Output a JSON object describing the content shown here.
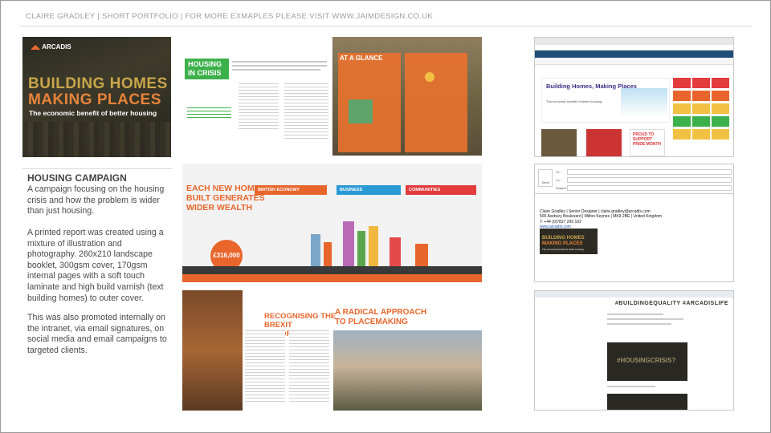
{
  "header": {
    "text": "CLAIRE GRADLEY | SHORT PORTFOLIO  |  FOR MORE EXMAPLES PLEASE VISIT WWW.JAIMDESIGN.CO.UK"
  },
  "cover": {
    "brand": "ARCADIS",
    "line1": "BUILDING HOMES",
    "line2": "MAKING PLACES",
    "subtitle": "The economic benefit of better housing"
  },
  "campaign": {
    "title": "HOUSING CAMPAIGN",
    "para1": "A campaign focusing on the housing crisis and how the problem is wider than just housing.",
    "para2": "A printed report was created using a mixture of illustration and photography. 260x210 landscape booklet, 300gsm cover, 170gsm internal pages with a soft touch laminate and high build varnish (text building homes) to outer cover.",
    "para3": "This was also promoted internally on the intranet, via email signatures, on social media and email campaigns to targeted clients."
  },
  "spreads": {
    "s1_left_title": "HOUSING IN CRISIS",
    "s1_right_title": "AT A GLANCE",
    "s2_title": "EACH NEW HOME BUILT GENERATES WIDER WEALTH",
    "s2_bands": [
      "BRITISH ECONOMY",
      "BUSINESS",
      "COMMUNITIES"
    ],
    "s2_circle": "£316,000",
    "s3_left_title": "RECOGNISING THE BREXIT OPPORTUNITY",
    "s3_right_title": "A RADICAL APPROACH TO PLACEMAKING"
  },
  "intranet": {
    "hero_title": "Building Homes, Making Places",
    "hero_sub": "The economic benefit of better housing",
    "proud": "PROUD TO SUPPORT PRIDE MONTH"
  },
  "email": {
    "send": "Send",
    "to": "To...",
    "cc": "Cc...",
    "subject": "Subject",
    "name_line": "Claire Gradley | Senior Designer | claire.gradley@arcadis.com",
    "address": "500 Avebury Boulevard | Milton Keynes | MK9 2BE | United Kingdom",
    "phone": "T: +44 (0)7827 295 102",
    "web": "www.arcadis.com",
    "mini1": "BUILDING HOMES",
    "mini2": "MAKING PLACES",
    "mini3": "The economic benefit of better housing"
  },
  "social": {
    "hashtag_banner": "#BUILDINGEQUALITY #ARCADISLIFE",
    "card_hashtag": "#HOUSINGCRISIS?"
  },
  "colors": {
    "accent_orange": "#e8662c",
    "accent_green": "#3cb04a",
    "cover_gold": "#c9a64a"
  }
}
